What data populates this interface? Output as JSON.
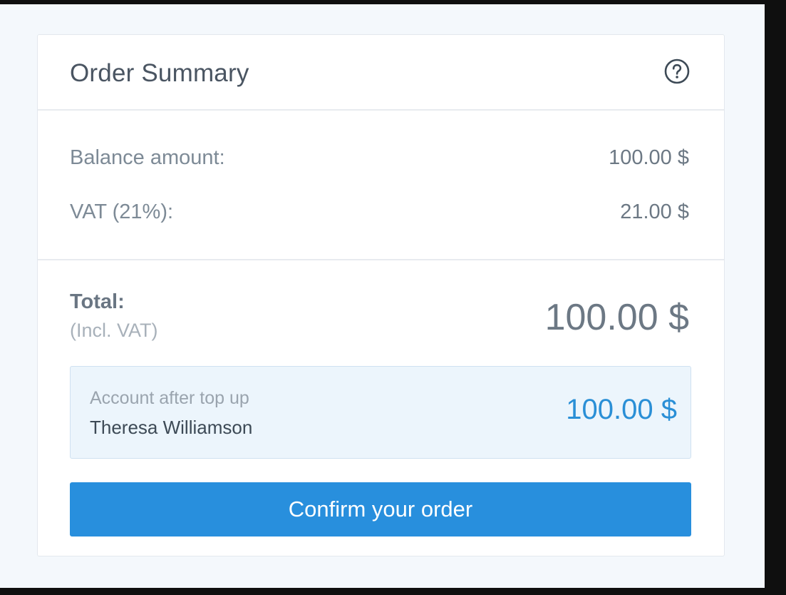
{
  "order_summary": {
    "title": "Order Summary",
    "help_icon": "question-circle-icon",
    "lines": [
      {
        "label": "Balance amount:",
        "value": "100.00 $"
      },
      {
        "label": "VAT (21%):",
        "value": "21.00 $"
      }
    ],
    "total": {
      "label": "Total:",
      "sublabel": "(Incl. VAT)",
      "value": "100.00 $"
    },
    "account": {
      "caption": "Account after top up",
      "name": "Theresa Williamson",
      "value": "100.00 $"
    },
    "confirm_label": "Confirm your order"
  },
  "colors": {
    "accent": "#288fdd",
    "account_value": "#2a8fd6",
    "account_background": "#ecf5fc",
    "page_background": "#f4f8fc",
    "text_muted": "#7d8a96"
  }
}
